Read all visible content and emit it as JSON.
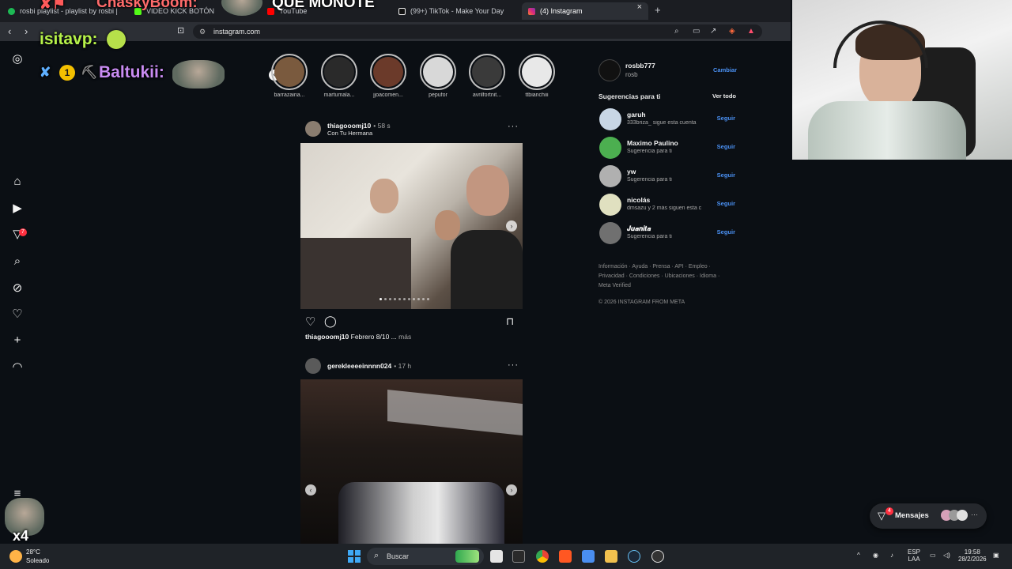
{
  "browser": {
    "tabs": [
      {
        "label": "rosbi playlist - playlist by rosbi | Spoti",
        "color": "#1db954"
      },
      {
        "label": "VIDEO KICK BOTÓN",
        "color": "#53fc18"
      },
      {
        "label": "YouTube",
        "color": "#ff0000"
      },
      {
        "label": "(99+) TikTok - Make Your Day",
        "color": "#ffffff"
      },
      {
        "label": "(4) Instagram",
        "color": "#e1306c"
      }
    ],
    "new_tab": "+",
    "close_tab": "×",
    "url": "instagram.com"
  },
  "stream_overlays": {
    "top_name": "ChaskyBoom:",
    "top_message": "QUE MONOTE",
    "user1": "isitavp:",
    "user2": "Baltukii:",
    "user2_badge": "1",
    "multiplier": "x4"
  },
  "stories": [
    {
      "name": "barrazaina...",
      "color": "#7a5a3e"
    },
    {
      "name": "martumala...",
      "color": "#2a2a2a"
    },
    {
      "name": "jjoacomen...",
      "color": "#6b3a2a"
    },
    {
      "name": "pepufor",
      "color": "#d8d8d8"
    },
    {
      "name": "avrilfortnit...",
      "color": "#3a3a3a"
    },
    {
      "name": "ttbianchiii",
      "color": "#e8e8e8"
    }
  ],
  "posts": [
    {
      "user": "thiagooomj10",
      "time": "• 58 s",
      "subtitle": "Con Tu Hermana",
      "caption_user": "thiagooomj10",
      "caption_text": "Febrero 8/10 ...",
      "caption_more": "más"
    },
    {
      "user": "gerekleeeeinnnn024",
      "time": "• 17 h"
    }
  ],
  "sidebar_right": {
    "account_user": "rosbb777",
    "account_name": "rosb",
    "switch_label": "Cambiar",
    "suggestions_title": "Sugerencias para ti",
    "see_all": "Ver todo",
    "suggestions": [
      {
        "name": "garuh",
        "sub": "333briza_ sigue esta cuenta",
        "follow": "Seguir",
        "color": "#c8d6e5"
      },
      {
        "name": "Maximo Paulino",
        "sub": "Sugerencia para ti",
        "follow": "Seguir",
        "color": "#4caf50"
      },
      {
        "name": "yw",
        "sub": "Sugerencia para ti",
        "follow": "Seguir",
        "color": "#b0b0b0"
      },
      {
        "name": "nicolás",
        "sub": "dmsazu y 2 más siguen esta c",
        "follow": "Seguir",
        "color": "#e0e0c0"
      },
      {
        "name": "𝑱𝒖𝒂𝒏𝒊𝒕𝒂",
        "sub": "Sugerencia para ti",
        "follow": "Seguir",
        "color": "#707070"
      }
    ],
    "footer_line1": "Información · Ayuda · Prensa · API · Empleo ·",
    "footer_line2": "Privacidad · Condiciones · Ubicaciones · Idioma ·",
    "footer_line3": "Meta Verified",
    "copyright": "© 2026 INSTAGRAM FROM META"
  },
  "rail": {
    "notifications_badge": "7"
  },
  "messages": {
    "label": "Mensajes",
    "badge": "4",
    "more": "···"
  },
  "taskbar": {
    "weather_temp": "28°C",
    "weather_text": "Soleado",
    "search_placeholder": "Buscar",
    "lang1": "ESP",
    "lang2": "LAA",
    "time": "19:58",
    "date": "28/2/2026"
  }
}
